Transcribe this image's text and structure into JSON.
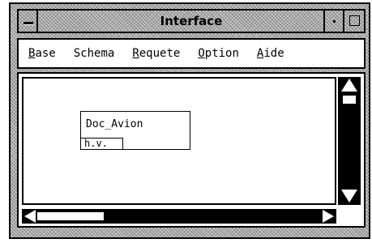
{
  "window": {
    "title": "Interface",
    "menu_icon": "window-menu-icon",
    "minimize_icon": "minimize-icon",
    "maximize_icon": "maximize-icon"
  },
  "menubar": {
    "items": [
      {
        "label": "Base",
        "mnemonic": "B"
      },
      {
        "label": "Schema",
        "mnemonic": ""
      },
      {
        "label": "Requete",
        "mnemonic": "R"
      },
      {
        "label": "Option",
        "mnemonic": "O"
      },
      {
        "label": "Aide",
        "mnemonic": "A"
      }
    ]
  },
  "canvas": {
    "entity": {
      "name": "Doc_Avion",
      "attribute": "h.v."
    }
  },
  "scrollbars": {
    "vertical": {
      "up_icon": "arrow-up-icon",
      "down_icon": "arrow-down-icon"
    },
    "horizontal": {
      "left_icon": "arrow-left-icon",
      "right_icon": "arrow-right-icon"
    }
  }
}
